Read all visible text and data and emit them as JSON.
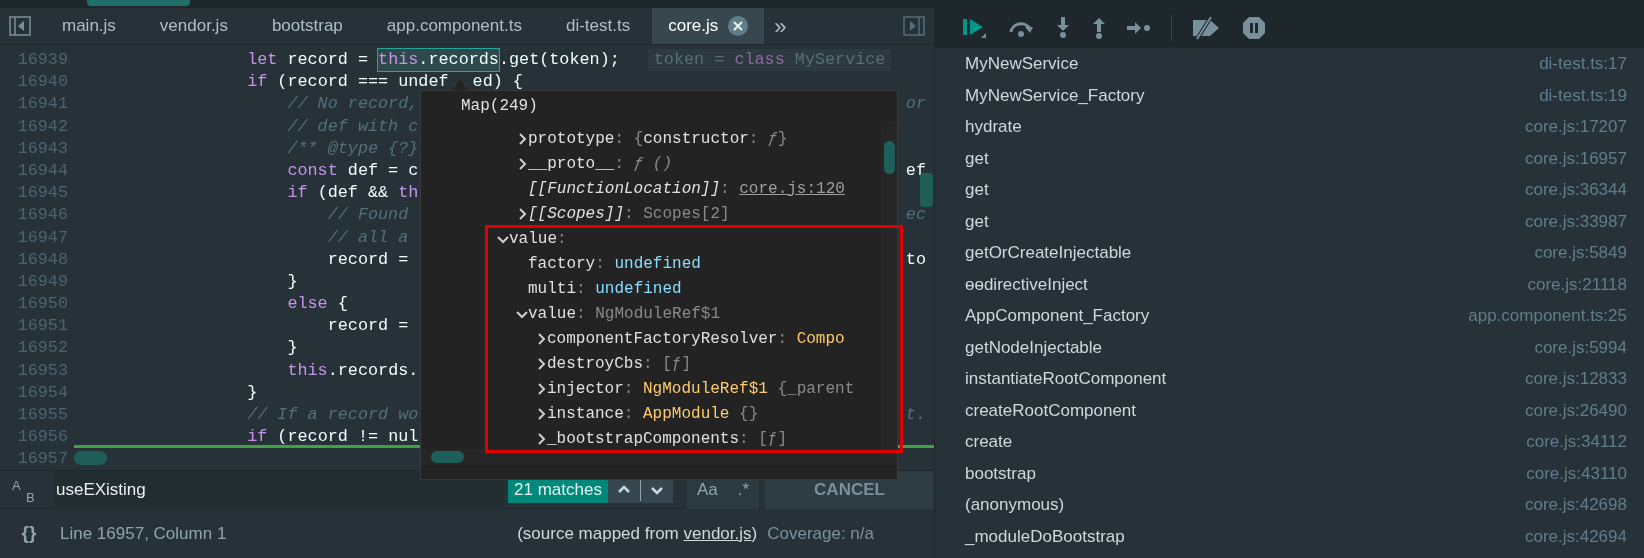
{
  "tabs": [
    {
      "label": "main.js",
      "selected": false
    },
    {
      "label": "vendor.js",
      "selected": false
    },
    {
      "label": "bootstrap",
      "selected": false
    },
    {
      "label": "app.component.ts",
      "selected": false
    },
    {
      "label": "di-test.ts",
      "selected": false
    },
    {
      "label": "core.js",
      "selected": true
    }
  ],
  "tabs_overflow": "»",
  "code": {
    "lines": [
      {
        "number": "16939",
        "current": false,
        "chunks": [
          {
            "kind": "code",
            "spans": [
              {
                "text": "                let",
                "kind": "keyword"
              },
              {
                "text": " record = ",
                "kind": "plain"
              }
            ]
          },
          {
            "kind": "match",
            "spans": [
              {
                "text": "this",
                "kind": "keyword"
              },
              {
                "text": ".records",
                "kind": "plain"
              }
            ]
          },
          {
            "kind": "code",
            "spans": [
              {
                "text": ".get(token);",
                "kind": "plain"
              }
            ]
          },
          {
            "kind": "hint",
            "spans": [
              {
                "text": "token = ",
                "kind": "dim"
              },
              {
                "text": "class",
                "kind": "keyword_dim"
              },
              {
                "text": " MyService",
                "kind": "dim"
              }
            ]
          }
        ]
      },
      {
        "number": "16940",
        "current": false,
        "chunks": [
          {
            "kind": "code",
            "spans": [
              {
                "text": "                if",
                "kind": "keyword"
              },
              {
                "text": " (record === undef",
                "kind": "plain"
              }
            ]
          },
          {
            "kind": "covered_code",
            "spans": [
              {
                "text": "ed) {",
                "kind": "plain"
              }
            ]
          }
        ]
      },
      {
        "number": "16941",
        "current": false,
        "chunks": [
          {
            "kind": "code",
            "spans": [
              {
                "text": "                    // No record,",
                "kind": "comment"
              }
            ]
          },
          {
            "kind": "edge_code",
            "spans": [
              {
                "text": "or",
                "kind": "comment"
              }
            ]
          }
        ]
      },
      {
        "number": "16942",
        "current": false,
        "chunks": [
          {
            "kind": "code",
            "spans": [
              {
                "text": "                    // def with c",
                "kind": "comment"
              }
            ]
          }
        ]
      },
      {
        "number": "16943",
        "current": false,
        "chunks": [
          {
            "kind": "code",
            "spans": [
              {
                "text": "                    /** @type {?}",
                "kind": "comment"
              }
            ]
          }
        ]
      },
      {
        "number": "16944",
        "current": false,
        "chunks": [
          {
            "kind": "code",
            "spans": [
              {
                "text": "                    const",
                "kind": "keyword"
              },
              {
                "text": " def = c",
                "kind": "plain"
              }
            ]
          },
          {
            "kind": "edge_code",
            "spans": [
              {
                "text": "ef",
                "kind": "plain"
              }
            ]
          }
        ]
      },
      {
        "number": "16945",
        "current": false,
        "chunks": [
          {
            "kind": "code",
            "spans": [
              {
                "text": "                    if",
                "kind": "keyword"
              },
              {
                "text": " (def && ",
                "kind": "plain"
              },
              {
                "text": "th",
                "kind": "keyword"
              }
            ]
          }
        ]
      },
      {
        "number": "16946",
        "current": false,
        "chunks": [
          {
            "kind": "code",
            "spans": [
              {
                "text": "                        // Found",
                "kind": "comment"
              }
            ]
          },
          {
            "kind": "edge_code",
            "spans": [
              {
                "text": "ec",
                "kind": "comment"
              }
            ]
          }
        ]
      },
      {
        "number": "16947",
        "current": false,
        "chunks": [
          {
            "kind": "code",
            "spans": [
              {
                "text": "                        // all a",
                "kind": "comment"
              }
            ]
          }
        ]
      },
      {
        "number": "16948",
        "current": false,
        "chunks": [
          {
            "kind": "code",
            "spans": [
              {
                "text": "                        record =",
                "kind": "plain"
              }
            ]
          },
          {
            "kind": "edge_code",
            "spans": [
              {
                "text": "to",
                "kind": "plain"
              }
            ]
          }
        ]
      },
      {
        "number": "16949",
        "current": false,
        "chunks": [
          {
            "kind": "code",
            "spans": [
              {
                "text": "                    }",
                "kind": "plain"
              }
            ]
          }
        ]
      },
      {
        "number": "16950",
        "current": false,
        "chunks": [
          {
            "kind": "code",
            "spans": [
              {
                "text": "                    else",
                "kind": "keyword"
              },
              {
                "text": " {",
                "kind": "plain"
              }
            ]
          }
        ]
      },
      {
        "number": "16951",
        "current": false,
        "chunks": [
          {
            "kind": "code",
            "spans": [
              {
                "text": "                        record =",
                "kind": "plain"
              }
            ]
          }
        ]
      },
      {
        "number": "16952",
        "current": false,
        "chunks": [
          {
            "kind": "code",
            "spans": [
              {
                "text": "                    }",
                "kind": "plain"
              }
            ]
          }
        ]
      },
      {
        "number": "16953",
        "current": false,
        "chunks": [
          {
            "kind": "code",
            "spans": [
              {
                "text": "                    this",
                "kind": "keyword"
              },
              {
                "text": ".records.",
                "kind": "plain"
              }
            ]
          }
        ]
      },
      {
        "number": "16954",
        "current": false,
        "chunks": [
          {
            "kind": "code",
            "spans": [
              {
                "text": "                }",
                "kind": "plain"
              }
            ]
          }
        ]
      },
      {
        "number": "16955",
        "current": false,
        "chunks": [
          {
            "kind": "code",
            "spans": [
              {
                "text": "                // If a record wo",
                "kind": "comment"
              }
            ]
          },
          {
            "kind": "edge_code",
            "spans": [
              {
                "text": "t.",
                "kind": "comment"
              }
            ]
          }
        ]
      },
      {
        "number": "16956",
        "current": false,
        "chunks": [
          {
            "kind": "code",
            "spans": [
              {
                "text": "                if",
                "kind": "keyword"
              },
              {
                "text": " (record != nul",
                "kind": "plain"
              }
            ]
          }
        ]
      },
      {
        "number": "16957",
        "current": true
      }
    ]
  },
  "popup": {
    "title": "Map(249)",
    "scrolled_children": [
      {
        "key": "prototype",
        "kind": "property",
        "separator": ":",
        "expanded": false,
        "value": [
          {
            "text": "{",
            "kind": "punct"
          },
          {
            "text": "constructor",
            "kind": "key"
          },
          {
            "text": ": ",
            "kind": "punct"
          },
          {
            "text": "ƒ",
            "kind": "fn"
          },
          {
            "text": "}",
            "kind": "punct"
          }
        ]
      },
      {
        "key": "__proto__",
        "kind": "property",
        "separator": ":",
        "expanded": false,
        "value": [
          {
            "text": "ƒ ()",
            "kind": "fn"
          }
        ]
      },
      {
        "key": "[[FunctionLocation]]",
        "kind": "internal",
        "separator": ":",
        "value": [
          {
            "text": "core.js:120",
            "kind": "link"
          }
        ]
      },
      {
        "key": "[[Scopes]]",
        "kind": "internal",
        "separator": ":",
        "expanded": false,
        "value": [
          {
            "text": "Scopes[2]",
            "kind": "punct"
          }
        ]
      }
    ],
    "tree": [
      {
        "key": "value",
        "kind": "property",
        "separator": ":",
        "expanded": true,
        "children": [
          {
            "key": "factory",
            "kind": "property",
            "separator": ":",
            "value": [
              {
                "text": "undefined",
                "kind": "undefined"
              }
            ]
          },
          {
            "key": "multi",
            "kind": "property",
            "separator": ":",
            "value": [
              {
                "text": "undefined",
                "kind": "undefined"
              }
            ]
          },
          {
            "key": "value",
            "kind": "property",
            "separator": ":",
            "expanded": true,
            "value": [
              {
                "text": "NgModuleRef$1",
                "kind": "punct"
              }
            ],
            "children": [
              {
                "key": "componentFactoryResolver",
                "kind": "property",
                "separator": ":",
                "expanded": false,
                "value": [
                  {
                    "text": "Compo",
                    "kind": "class"
                  }
                ]
              },
              {
                "key": "destroyCbs",
                "kind": "property",
                "separator": ":",
                "expanded": false,
                "value": [
                  {
                    "text": "[ƒ]",
                    "kind": "punct"
                  }
                ]
              },
              {
                "key": "injector",
                "kind": "property",
                "separator": ":",
                "expanded": false,
                "value": [
                  {
                    "text": "NgModuleRef$1",
                    "kind": "class"
                  },
                  {
                    "text": " {_parent",
                    "kind": "punct"
                  }
                ]
              },
              {
                "key": "instance",
                "kind": "property",
                "separator": ":",
                "expanded": false,
                "value": [
                  {
                    "text": "AppModule",
                    "kind": "class"
                  },
                  {
                    "text": " {}",
                    "kind": "punct"
                  }
                ]
              },
              {
                "key": "_bootstrapComponents",
                "kind": "property",
                "separator": ":",
                "expanded": false,
                "value": [
                  {
                    "text": "[ƒ]",
                    "kind": "punct"
                  }
                ]
              }
            ]
          }
        ]
      }
    ]
  },
  "find": {
    "replace_toggle": {
      "from": "A",
      "to": "B"
    },
    "query": "useEXisting",
    "matches": "21 matches",
    "case_toggle": "Aa",
    "regex_toggle": ".*",
    "cancel": "CANCEL"
  },
  "status_bar": {
    "pretty_print": "{}",
    "position": "Line 16957, Column 1",
    "source_prefix": "(source mapped from ",
    "source_link": "vendor.js",
    "source_suffix": ")",
    "coverage": "Coverage: n/a"
  },
  "call_stack": [
    {
      "name": "MyNewService",
      "location": "di-test.ts:17"
    },
    {
      "name": "MyNewService_Factory",
      "location": "di-test.ts:19"
    },
    {
      "name": "hydrate",
      "location": "core.js:17207"
    },
    {
      "name": "get",
      "location": "core.js:16957"
    },
    {
      "name": "get",
      "location": "core.js:36344"
    },
    {
      "name": "get",
      "location": "core.js:33987"
    },
    {
      "name": "getOrCreateInjectable",
      "location": "core.js:5849"
    },
    {
      "name": "ɵɵdirectiveInject",
      "location": "core.js:21118"
    },
    {
      "name": "AppComponent_Factory",
      "location": "app.component.ts:25"
    },
    {
      "name": "getNodeInjectable",
      "location": "core.js:5994"
    },
    {
      "name": "instantiateRootComponent",
      "location": "core.js:12833"
    },
    {
      "name": "createRootComponent",
      "location": "core.js:26490"
    },
    {
      "name": "create",
      "location": "core.js:34112"
    },
    {
      "name": "bootstrap",
      "location": "core.js:43110"
    },
    {
      "name": "(anonymous)",
      "location": "core.js:42698"
    },
    {
      "name": "_moduleDoBootstrap",
      "location": "core.js:42694"
    }
  ]
}
